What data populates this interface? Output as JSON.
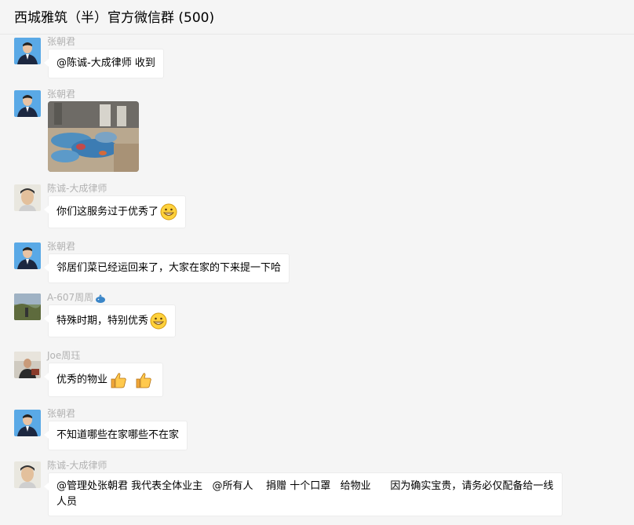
{
  "chat": {
    "title": "西城雅筑（半）官方微信群 (500)"
  },
  "messages": [
    {
      "sender": "张朝君",
      "text": "@陈诚-大成律师 收到"
    },
    {
      "sender": "张朝君",
      "image": "photo of bagged vegetables on ground"
    },
    {
      "sender": "陈诚-大成律师",
      "text": "你们这服务过于优秀了",
      "emoji": "grin-emoji"
    },
    {
      "sender": "张朝君",
      "text": "邻居们菜已经运回来了，大家在家的下来提一下哈"
    },
    {
      "sender": "A-607周周",
      "sender_icon": "whale-icon",
      "text": "特殊时期，特别优秀",
      "emoji": "grin-emoji"
    },
    {
      "sender": "Joe周珏",
      "text": "优秀的物业",
      "emoji": "thumbs-up-emoji"
    },
    {
      "sender": "张朝君",
      "text": "不知道哪些在家哪些不在家"
    },
    {
      "sender": "陈诚-大成律师",
      "text": "@管理处张朝君 我代表全体业主   @所有人    捐赠 十个口罩   给物业      因为确实宝贵，请务必仅配备给一线人员"
    }
  ]
}
